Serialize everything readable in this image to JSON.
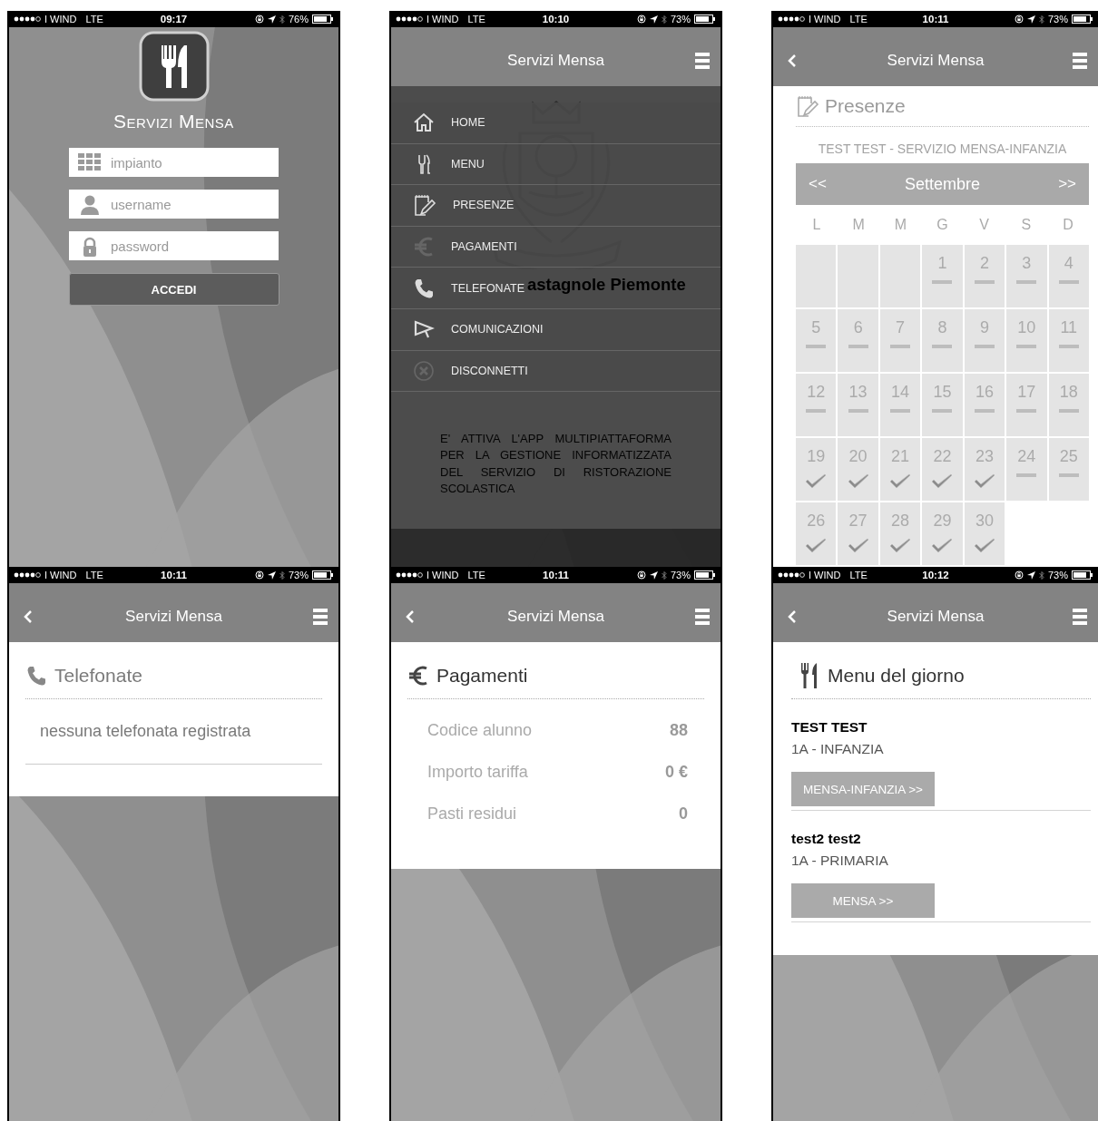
{
  "screens": [
    {
      "kind": "login",
      "status": {
        "carrier": "I WIND",
        "network": "LTE",
        "time": "09:17",
        "battery": "76%"
      },
      "app_name": "Servizi Mensa",
      "fields": [
        {
          "kind": "plant",
          "placeholder": "impianto"
        },
        {
          "kind": "user",
          "placeholder": "username"
        },
        {
          "kind": "password",
          "placeholder": "password"
        }
      ],
      "submit": "ACCEDI"
    },
    {
      "kind": "drawer",
      "status": {
        "carrier": "I WIND",
        "network": "LTE",
        "time": "10:10",
        "battery": "73%"
      },
      "header": {
        "title": "Servizi Mensa"
      },
      "menu_items": [
        {
          "kind": "home",
          "label": "HOME"
        },
        {
          "kind": "menu",
          "label": "MENU"
        },
        {
          "kind": "attendance",
          "label": "PRESENZE"
        },
        {
          "kind": "payments",
          "label": "PAGAMENTI"
        },
        {
          "kind": "calls",
          "label": "TELEFONATE"
        },
        {
          "kind": "messages",
          "label": "COMUNICAZIONI"
        },
        {
          "kind": "logout",
          "label": "DISCONNETTI"
        }
      ],
      "background": {
        "title": "astagnole Piemonte",
        "text": "E' ATTIVA L'APP MULTIPIATTAFORMA PER LA GESTIONE INFORMATIZZATA DEL SERVIZIO DI RISTORAZIONE SCOLASTICA"
      }
    },
    {
      "kind": "attendance",
      "status": {
        "carrier": "I WIND",
        "network": "LTE",
        "time": "10:11",
        "battery": "73%"
      },
      "header": {
        "title": "Servizi Mensa",
        "back_button": true
      },
      "title": "Presenze",
      "subtitle": "TEST TEST - SERVIZIO MENSA-INFANZIA",
      "calendar": {
        "prev": "<<",
        "month": "Settembre",
        "next": ">>",
        "weekdays": [
          "L",
          "M",
          "M",
          "G",
          "V",
          "S",
          "D"
        ],
        "days": [
          {
            "kind": "blank"
          },
          {
            "kind": "blank"
          },
          {
            "kind": "blank"
          },
          {
            "day": "1",
            "kind": "dash"
          },
          {
            "day": "2",
            "kind": "dash"
          },
          {
            "day": "3",
            "kind": "dash"
          },
          {
            "day": "4",
            "kind": "dash"
          },
          {
            "day": "5",
            "kind": "dash"
          },
          {
            "day": "6",
            "kind": "dash"
          },
          {
            "day": "7",
            "kind": "dash"
          },
          {
            "day": "8",
            "kind": "dash"
          },
          {
            "day": "9",
            "kind": "dash"
          },
          {
            "day": "10",
            "kind": "dash"
          },
          {
            "day": "11",
            "kind": "dash"
          },
          {
            "day": "12",
            "kind": "dash"
          },
          {
            "day": "13",
            "kind": "dash"
          },
          {
            "day": "14",
            "kind": "dash"
          },
          {
            "day": "15",
            "kind": "dash"
          },
          {
            "day": "16",
            "kind": "dash"
          },
          {
            "day": "17",
            "kind": "dash"
          },
          {
            "day": "18",
            "kind": "dash"
          },
          {
            "day": "19",
            "kind": "check"
          },
          {
            "day": "20",
            "kind": "check"
          },
          {
            "day": "21",
            "kind": "check"
          },
          {
            "day": "22",
            "kind": "check"
          },
          {
            "day": "23",
            "kind": "check"
          },
          {
            "day": "24",
            "kind": "dash"
          },
          {
            "day": "25",
            "kind": "dash"
          },
          {
            "day": "26",
            "kind": "check"
          },
          {
            "day": "27",
            "kind": "check"
          },
          {
            "day": "28",
            "kind": "check"
          },
          {
            "day": "29",
            "kind": "check"
          },
          {
            "day": "30",
            "kind": "check"
          }
        ]
      }
    },
    {
      "kind": "calls",
      "status": {
        "carrier": "I WIND",
        "network": "LTE",
        "time": "10:11",
        "battery": "73%"
      },
      "header": {
        "title": "Servizi Mensa",
        "back_button": true
      },
      "title": "Telefonate",
      "message": "nessuna telefonata registrata"
    },
    {
      "kind": "payments",
      "status": {
        "carrier": "I WIND",
        "network": "LTE",
        "time": "10:11",
        "battery": "73%"
      },
      "header": {
        "title": "Servizi Mensa",
        "back_button": true
      },
      "title": "Pagamenti",
      "rows": [
        {
          "label": "Codice alunno",
          "value": "88"
        },
        {
          "label": "Importo tariffa",
          "value": "0 €"
        },
        {
          "label": "Pasti residui",
          "value": "0"
        }
      ]
    },
    {
      "kind": "daily_menu",
      "status": {
        "carrier": "I WIND",
        "network": "LTE",
        "time": "10:12",
        "battery": "73%"
      },
      "header": {
        "title": "Servizi Mensa",
        "back_button": true
      },
      "title": "Menu del giorno",
      "students": [
        {
          "name": "TEST TEST",
          "class": "1A - INFANZIA",
          "button": "MENSA-INFANZIA >>"
        },
        {
          "name": "test2 test2",
          "class": "1A - PRIMARIA",
          "button": "MENSA >>"
        }
      ]
    }
  ]
}
